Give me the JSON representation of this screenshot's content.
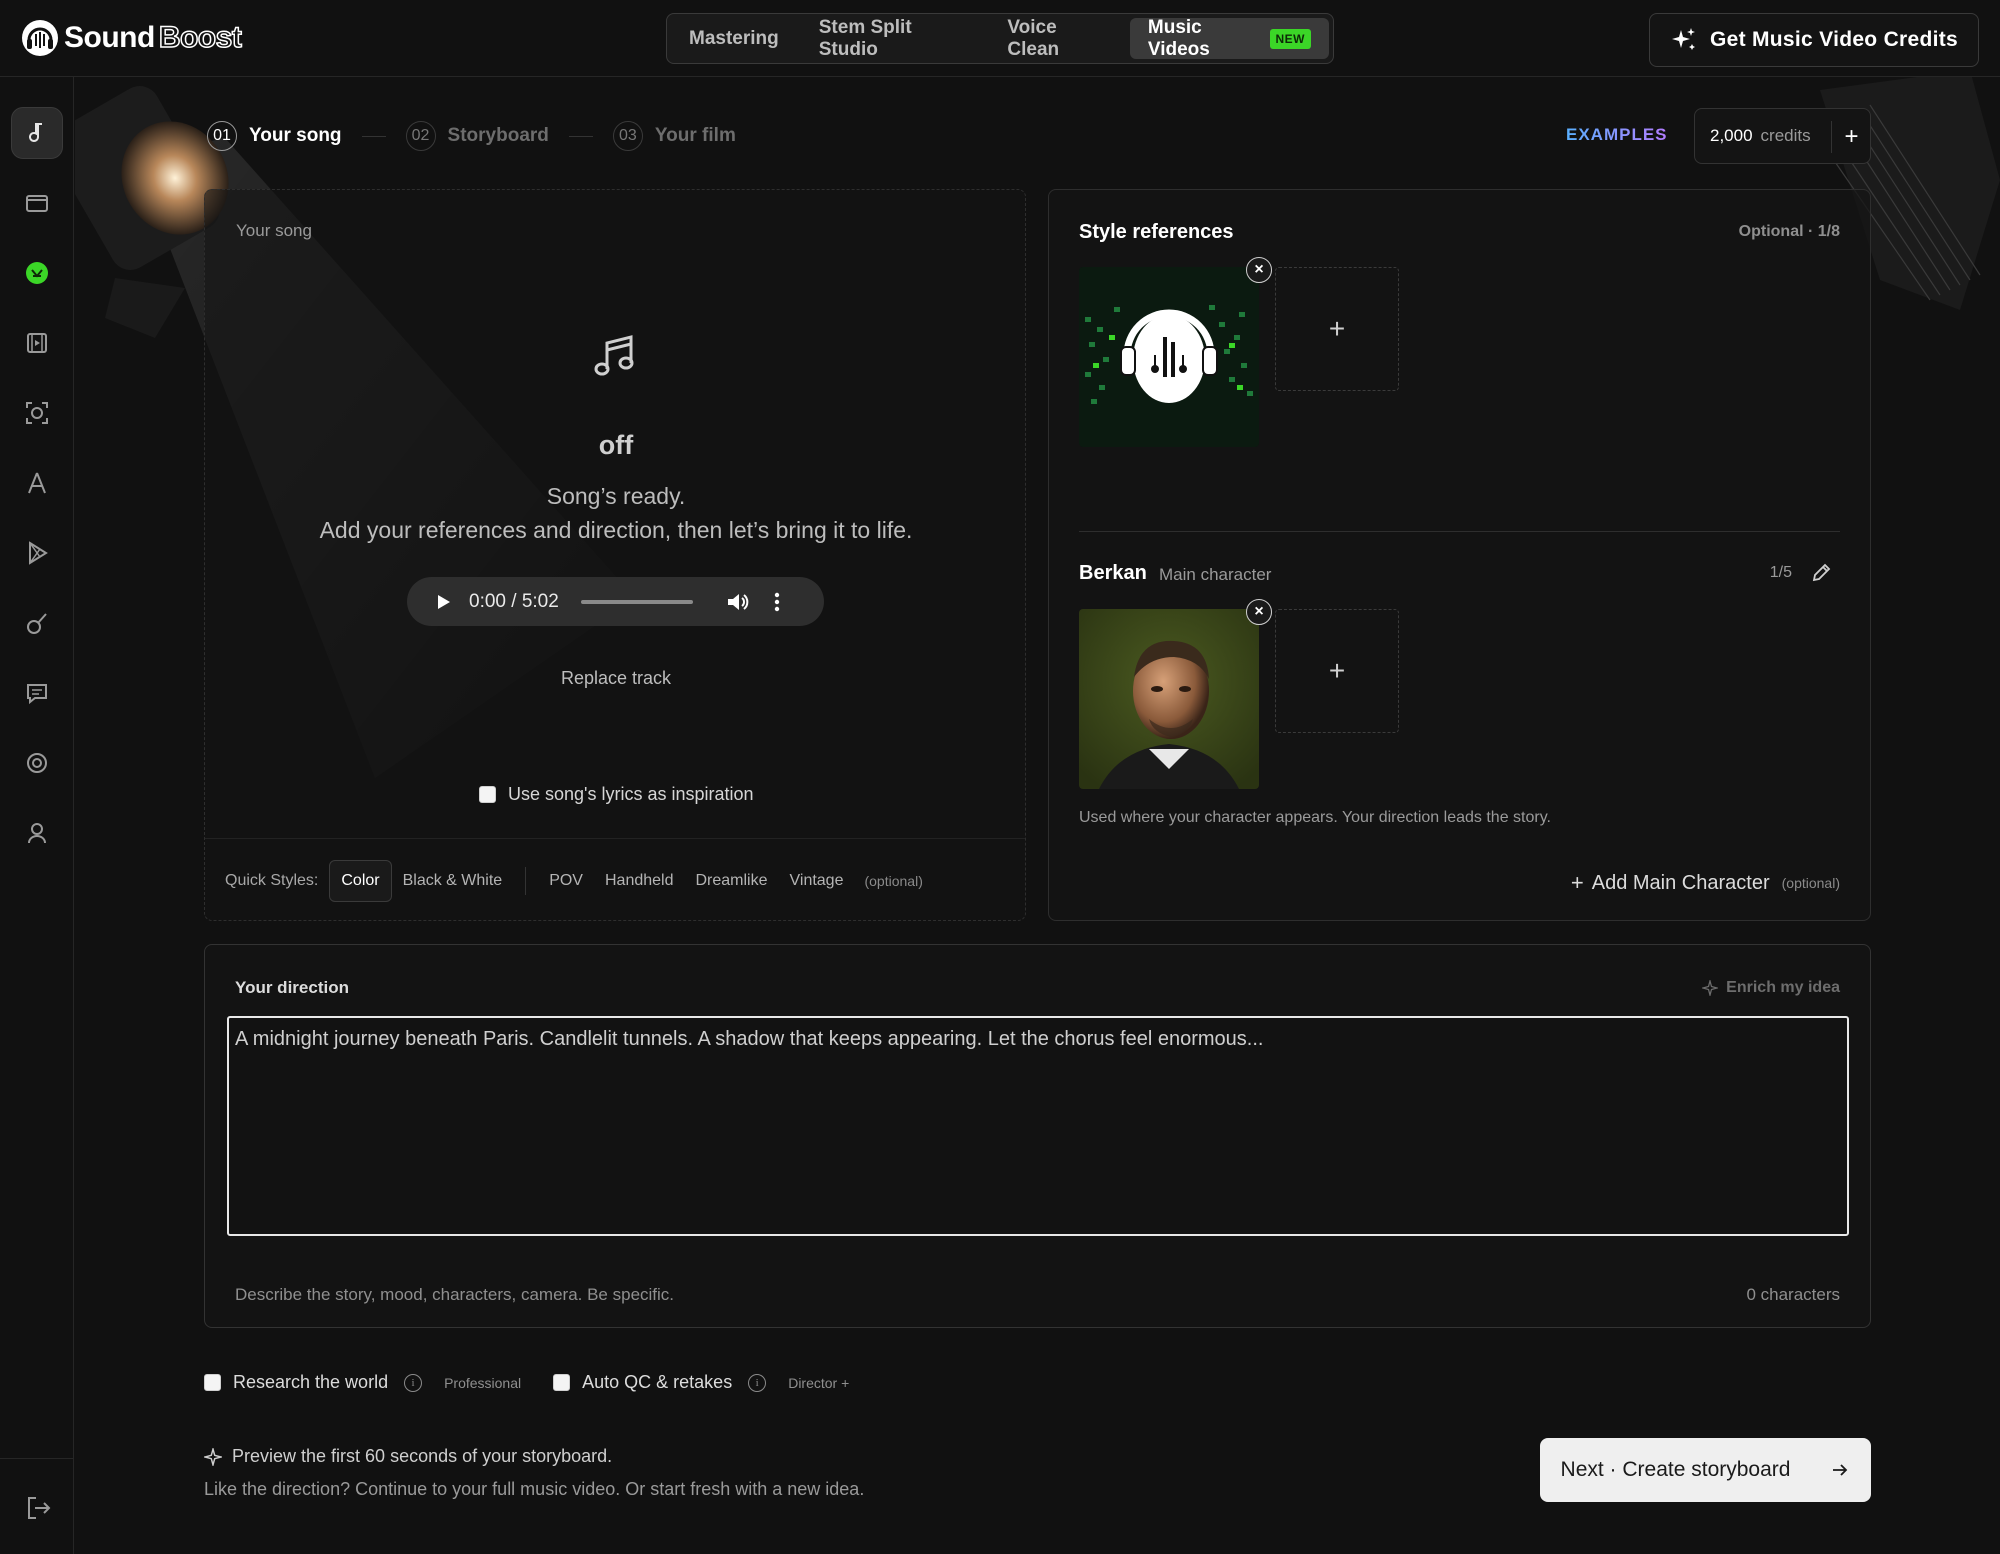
{
  "brand": {
    "name_a": "Sound",
    "name_b": "Boost"
  },
  "topnav": {
    "tabs": [
      {
        "label": "Mastering"
      },
      {
        "label": "Stem Split Studio"
      },
      {
        "label": "Voice Clean"
      },
      {
        "label": "Music Videos",
        "badge": "NEW"
      }
    ]
  },
  "header": {
    "credits_button": "Get Music Video Credits"
  },
  "stepper": {
    "steps": [
      {
        "num": "01",
        "label": "Your song"
      },
      {
        "num": "02",
        "label": "Storyboard"
      },
      {
        "num": "03",
        "label": "Your film"
      }
    ],
    "examples": "EXAMPLES",
    "credits_amount": "2,000",
    "credits_label": "credits",
    "add": "+"
  },
  "song": {
    "caption": "Your song",
    "name": "off",
    "ready_line1": "Song’s ready.",
    "ready_line2": "Add your references and direction, then let’s bring it to life.",
    "audio_time": "0:00 / 5:02",
    "replace": "Replace track",
    "lyrics_toggle": "Use song's lyrics as inspiration"
  },
  "quick_styles": {
    "label": "Quick Styles:",
    "group_a": [
      "Color",
      "Black & White"
    ],
    "group_b": [
      "POV",
      "Handheld",
      "Dreamlike",
      "Vintage"
    ],
    "optional": "(optional)"
  },
  "references": {
    "title": "Style references",
    "count": "Optional · 1/8",
    "add": "+"
  },
  "character": {
    "name": "Berkan",
    "role": "Main character",
    "count": "1/5",
    "add": "+",
    "hint": "Used where your character appears. Your direction leads the story.",
    "add_main": "Add Main Character",
    "add_main_optional": "(optional)"
  },
  "direction": {
    "title": "Your direction",
    "enrich": "Enrich my idea",
    "placeholder": "A midnight journey beneath Paris. Candlelit tunnels. A shadow that keeps appearing. Let the chorus feel enormous...",
    "hint": "Describe the story, mood, characters, camera. Be specific.",
    "count": "0 characters"
  },
  "options": {
    "research": "Research the world",
    "research_tier": "Professional",
    "autoqc": "Auto QC & retakes",
    "autoqc_tier": "Director +"
  },
  "footer": {
    "preview": "Preview the first 60 seconds of your storyboard.",
    "preview_sub": "Like the direction? Continue to your full music video. Or start fresh with a new idea.",
    "next": "Next · Create storyboard"
  },
  "colors": {
    "accent_green": "#3bd627",
    "background": "#111111",
    "examples_gradient": [
      "#5ab0ff",
      "#b47cff"
    ]
  }
}
